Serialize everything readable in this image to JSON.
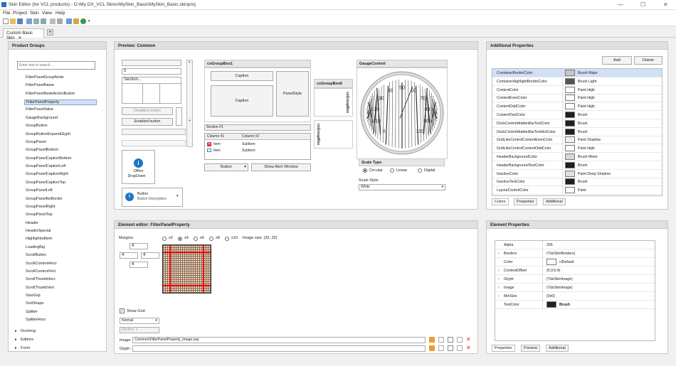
{
  "window": {
    "title": "Skin Editor (for VCL products) - D:\\My DX_VCL Skins\\MySkin_Basic\\MySkin_Basic.skinproj",
    "min": "—",
    "max": "☐",
    "close": "✕"
  },
  "menu": [
    "File",
    "Project",
    "Skin",
    "View",
    "Help"
  ],
  "tab": {
    "label": "Custom Basic Skin",
    "close": "✕",
    "add": "+"
  },
  "product_groups": {
    "title": "Product Groups",
    "search_placeholder": "Enter text to search...",
    "items": [
      "FilterPanelGroupNode",
      "FilterPanelName",
      "FilterPanelNodeActionButton",
      "FilterPanelProperty",
      "FilterPanelValue",
      "GaugeBackground",
      "GroupButton",
      "GroupButtonExpandGlyph",
      "GroupPanel",
      "GroupPanelBottom",
      "GroupPanelCaptionBottom",
      "GroupPanelCaptionLeft",
      "GroupPanelCaptionRight",
      "GroupPanelCaptionTop",
      "GroupPanelLeft",
      "GroupPanelNoBorder",
      "GroupPanelRight",
      "GroupPanelTop",
      "Header",
      "HeaderSpecial",
      "HighlightedItem",
      "LoadingBig",
      "ScrollButton",
      "ScrollContentHorz",
      "ScrollContentVert",
      "ScrollThumbHorz",
      "ScrollThumbVert",
      "SizeGrip",
      "SortShape",
      "Splitter",
      "SplitterHorz"
    ],
    "selected": "FilterPanelProperty",
    "groups": [
      "Docking",
      "Editors",
      "Form"
    ]
  },
  "preview": {
    "title": "Preview: Common",
    "combo_value": "0",
    "section": "Section...",
    "disabled_button": "Disabled button",
    "enabled_button": "Enabled button",
    "office_line1": "Office",
    "office_line2": "DropDown",
    "button_label": "Button",
    "button_desc": "Button Description",
    "group1": "cxGroupBox1",
    "caption1": "Caption",
    "caption2": "Caption",
    "panel_style": "PanelStyle",
    "group6": "cxGroupBox6",
    "group_side1": "cxGroupBox",
    "group_side2": "cxGroupBox",
    "section1": "Section #1",
    "col1": "Column #1",
    "col2": "Column #2",
    "item": "Item",
    "subitem": "SubItem",
    "button": "Button",
    "alert": "Show Alert Window",
    "gauge_title": "GaugeControl",
    "scale_type": "Scale Type",
    "circular": "Circular",
    "linear": "Linear",
    "digital": "Digital",
    "scale_style": "Scale Style",
    "scale_value": "White"
  },
  "gauge": {
    "ticks": [
      "0",
      "10",
      "20",
      "30",
      "40",
      "50",
      "60",
      "70",
      "80",
      "90",
      "100"
    ],
    "needle_value": 58
  },
  "additional": {
    "title": "Additional Properties",
    "add": "Add",
    "delete": "Delete",
    "rows": [
      {
        "n": "ContainerBorderColor",
        "c": "#c8c8c8",
        "v": "Brush Major"
      },
      {
        "n": "ContainerHighlightBorderColor",
        "c": "#555555",
        "v": "Brush Light"
      },
      {
        "n": "ContentColor",
        "c": "#ffffff",
        "v": "Paint High"
      },
      {
        "n": "ContentEvenColor",
        "c": "#ffffff",
        "v": "Paint High"
      },
      {
        "n": "ContentOddColor",
        "c": "#ffffff",
        "v": "Paint High"
      },
      {
        "n": "ContentTextColor",
        "c": "#202020",
        "v": "Brush"
      },
      {
        "n": "DockControlHiddenBarTextColor",
        "c": "#202020",
        "v": "Brush"
      },
      {
        "n": "DockControlHiddenBarTextHotColor",
        "c": "#202020",
        "v": "Brush"
      },
      {
        "n": "GridLikeControlContentEvenColor",
        "c": "#f0f0f0",
        "v": "Paint Shadow"
      },
      {
        "n": "GridLikeControlContentOddColor",
        "c": "#ffffff",
        "v": "Paint High"
      },
      {
        "n": "HeaderBackgroundColor",
        "c": "#d8d8d8",
        "v": "Brush Minor"
      },
      {
        "n": "HeaderBackgroundTextColor",
        "c": "#202020",
        "v": "Brush"
      },
      {
        "n": "InactiveColor",
        "c": "#e0e0e0",
        "v": "Paint Deep Shadow"
      },
      {
        "n": "InactiveTextColor",
        "c": "#202020",
        "v": "Brush"
      },
      {
        "n": "LayoutControlColor",
        "c": "#ffffff",
        "v": "Paint"
      }
    ],
    "tabs": [
      "Colors",
      "Properties",
      "Additional"
    ]
  },
  "element_editor": {
    "title": "Element editor: FilterPanelProperty",
    "margins": "Margins:",
    "m_top": "4",
    "m_left": "4",
    "m_right": "4",
    "m_bottom": "4",
    "zooms": [
      "x2",
      "x4",
      "x6",
      "x8",
      "x10"
    ],
    "size": "Image size: (32, 32)",
    "show_grid": "Show Grid",
    "state": "Normal",
    "section": "Section: 1",
    "image_label": "Image:",
    "image_value": "Common\\FilterPanelProperty_Image.svg",
    "glyph_label": "Glyph:"
  },
  "element_props": {
    "title": "Element Properties",
    "rows": [
      {
        "n": "Alpha",
        "v": "255",
        "exp": false
      },
      {
        "n": "Borders",
        "v": "(TdxSkinBorders)",
        "exp": true
      },
      {
        "n": "Color",
        "v": "clDefault",
        "exp": false,
        "sw": "#ffffff"
      },
      {
        "n": "ContentOffset",
        "v": "{5;3;5;4}",
        "exp": true
      },
      {
        "n": "Glyph",
        "v": "(TdxSkinImage)",
        "exp": true
      },
      {
        "n": "Image",
        "v": "(TdxSkinImage)",
        "exp": true
      },
      {
        "n": "MinSize",
        "v": "{0x0}",
        "exp": true
      },
      {
        "n": "TextColor",
        "v": "Brush",
        "exp": false,
        "sw": "#202020"
      }
    ],
    "tabs": [
      "Properties",
      "Preview",
      "Additional"
    ]
  }
}
